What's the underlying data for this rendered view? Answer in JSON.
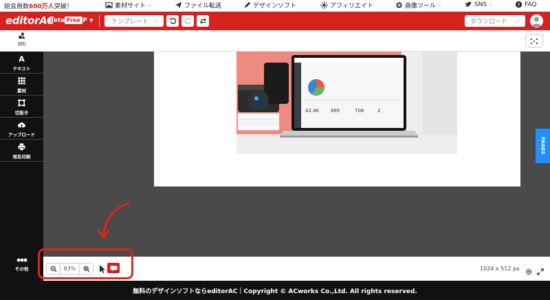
{
  "promo": {
    "prefix": "総会員数",
    "highlight": "600万人",
    "suffix": "突破！"
  },
  "topnav": [
    {
      "label": "素材サイト",
      "icon": "image-icon",
      "chevron": true
    },
    {
      "label": "ファイル転送",
      "icon": "send-icon",
      "chevron": false
    },
    {
      "label": "デザインソフト",
      "icon": "pencil-icon",
      "chevron": false
    },
    {
      "label": "アフィリエイト",
      "icon": "sparkle-icon",
      "chevron": false
    },
    {
      "label": "画像ツール",
      "icon": "gear-icon",
      "chevron": true
    },
    {
      "label": "SNS",
      "icon": "twitter-icon",
      "chevron": true
    },
    {
      "label": "FAQ",
      "icon": "help-icon",
      "chevron": false
    }
  ],
  "header": {
    "logo": "editorAC",
    "beta": "Beta",
    "free": "Free",
    "lang": "JP",
    "template": "テンプレート",
    "download": "ダウンロード",
    "color": "#d6211f"
  },
  "tools": {
    "shape": "図形"
  },
  "sidebar": [
    {
      "label": "テキスト",
      "icon": "text-icon"
    },
    {
      "label": "素材",
      "icon": "grid-icon"
    },
    {
      "label": "切抜き",
      "icon": "crop-icon"
    },
    {
      "label": "アップロード",
      "icon": "cloud-upload-icon"
    },
    {
      "label": "宛名印刷",
      "icon": "printer-icon"
    }
  ],
  "sidebar_more": "その他",
  "pages_tab": "PAGES",
  "zoom": "83%",
  "canvas_size": "1024 x 512 px",
  "footer": "無料のデザインソフトならeditorAC｜Copyright © ACworks Co.,Ltd. All rights reserved.",
  "mock_screen": {
    "stat1": "42.4K",
    "stat2": "665",
    "stat3": "706",
    "stat4": "2"
  },
  "highlight_color": "#e0241c"
}
